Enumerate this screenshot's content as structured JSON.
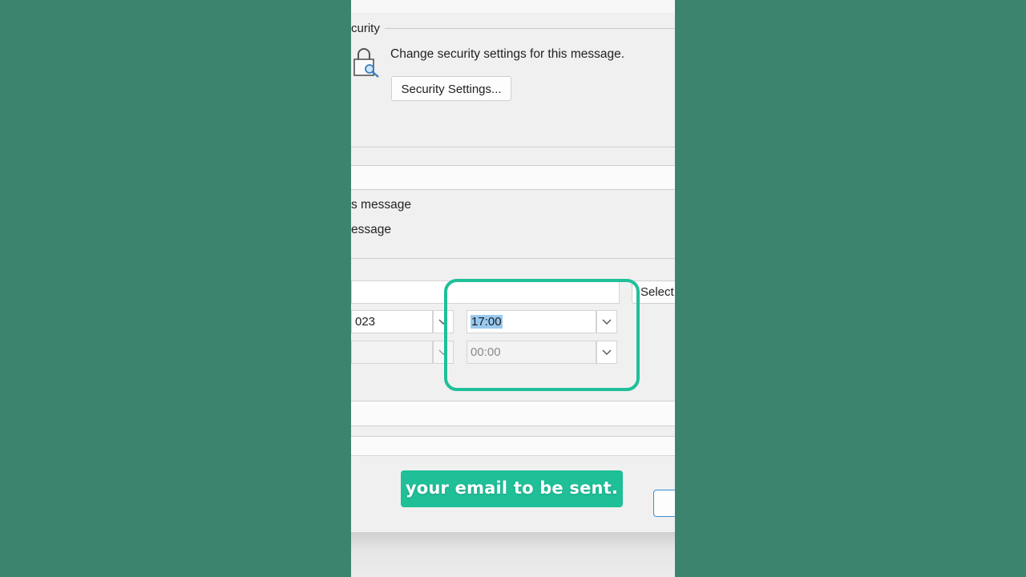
{
  "security": {
    "section_label": "curity",
    "description": "Change security settings for this message.",
    "settings_button": "Security Settings..."
  },
  "options": {
    "option1_text": "s message",
    "option2_text": "essage"
  },
  "delivery": {
    "select_button": "Select",
    "date_value": "023",
    "time_value": "17:00",
    "expires_time_value": "00:00"
  },
  "caption": {
    "text": "your email to be sent."
  },
  "colors": {
    "background": "#3e836d",
    "accent": "#1fbf98",
    "selection": "#99c9ef"
  },
  "icons": {
    "lock": "lock-key-icon",
    "dropdown": "chevron-down-icon"
  }
}
